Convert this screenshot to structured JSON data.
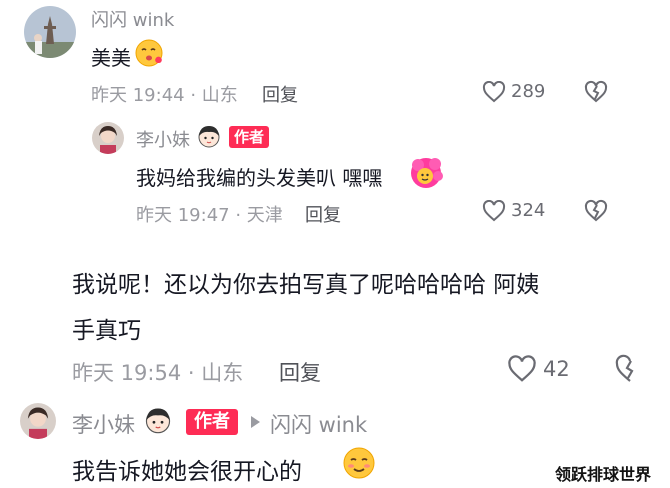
{
  "comments": [
    {
      "user": "闪闪 wink",
      "text": "美美",
      "time": "昨天 19:44",
      "location": "山东",
      "reply_label": "回复",
      "likes": "289",
      "avatar_icon": "avatar-tower-photo",
      "emoji_icon": "kiss-emoji-icon"
    },
    {
      "user": "李小妹",
      "author_badge": "作者",
      "text": "我妈给我编的头发美叭 嘿嘿",
      "time": "昨天 19:47",
      "location": "天津",
      "reply_label": "回复",
      "likes": "324",
      "avatar_icon": "avatar-woman-photo",
      "emoji_icon": "pink-hair-emoji-icon"
    },
    {
      "text_line1": "我说呢！还以为你去拍写真了呢哈哈哈哈 阿姨",
      "text_line2": "手真巧",
      "time": "昨天 19:54",
      "location": "山东",
      "reply_label": "回复",
      "likes": "42"
    },
    {
      "user": "李小妹",
      "author_badge": "作者",
      "reply_to": "闪闪 wink",
      "text": "我告诉她她会很开心的",
      "avatar_icon": "avatar-woman-photo",
      "emoji_icon": "shy-smile-emoji-icon"
    }
  ],
  "watermark": "领跃排球世界",
  "colors": {
    "badge": "#fe2c55",
    "name": "#8a8b91",
    "text": "#161823",
    "meta": "#9a9ba1"
  }
}
